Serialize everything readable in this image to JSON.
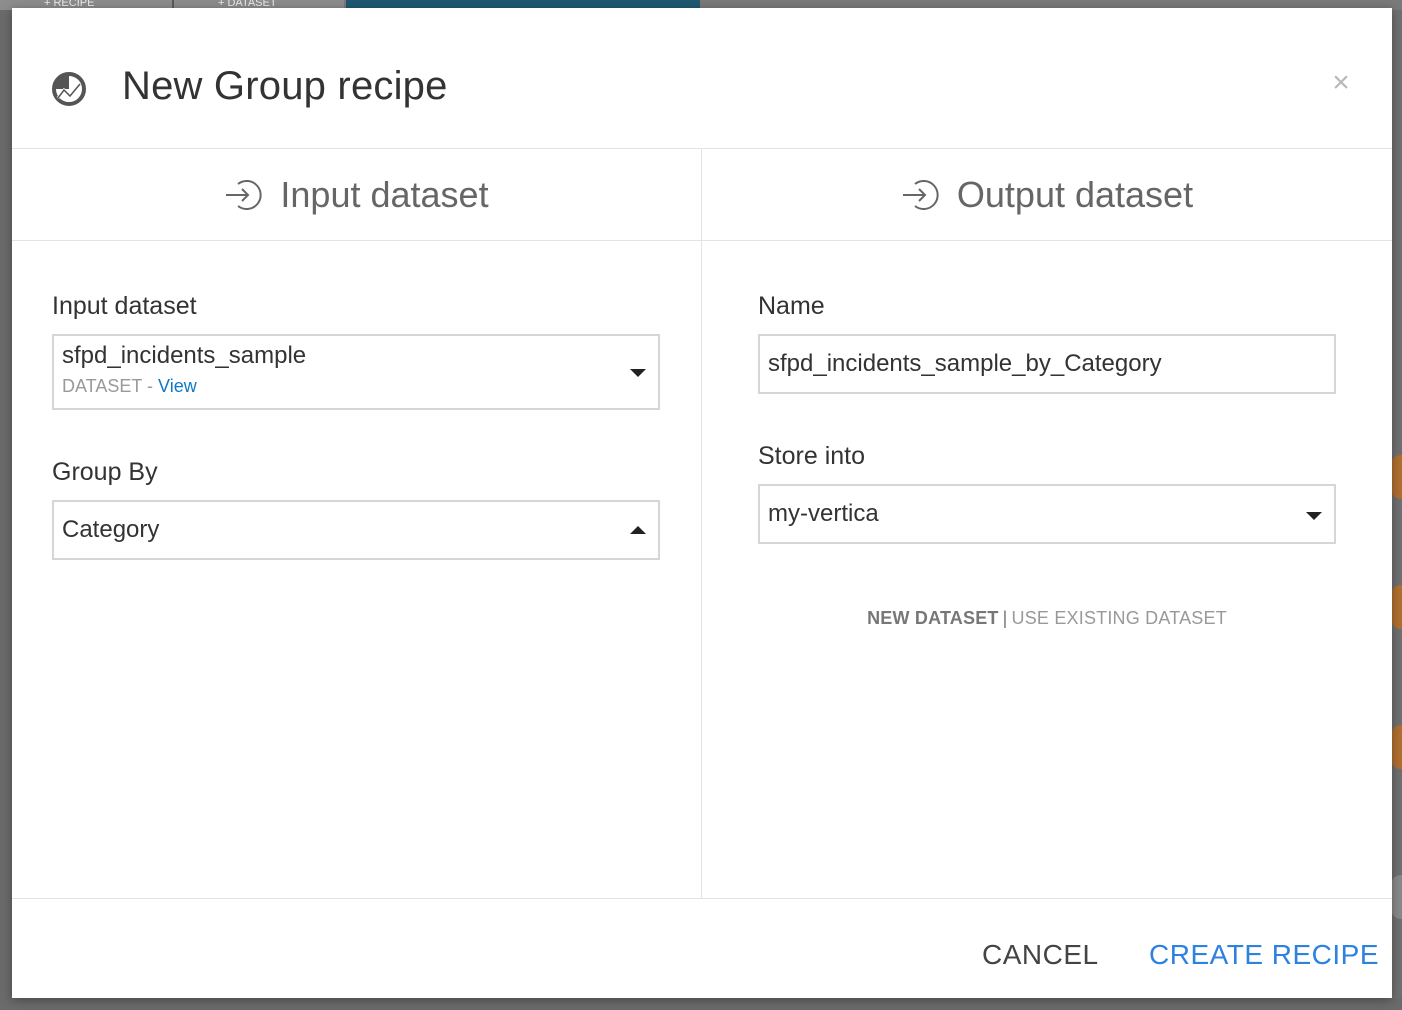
{
  "background": {
    "tabs": [
      "+ RECIPE",
      "+ DATASET"
    ]
  },
  "dialog": {
    "title": "New Group recipe",
    "close_symbol": "×",
    "icon": "recipe-group-icon"
  },
  "input_section": {
    "heading": "Input dataset",
    "icon": "arrow-in-icon",
    "input_dataset": {
      "label": "Input dataset",
      "value": "sfpd_incidents_sample",
      "type_label": "DATASET",
      "separator": " - ",
      "link_label": "View"
    },
    "group_by": {
      "label": "Group By",
      "value": "Category"
    }
  },
  "output_section": {
    "heading": "Output dataset",
    "icon": "arrow-in-icon",
    "name": {
      "label": "Name",
      "value": "sfpd_incidents_sample_by_Category"
    },
    "store_into": {
      "label": "Store into",
      "value": "my-vertica"
    },
    "mode": {
      "new_label": "NEW DATASET",
      "separator": "|",
      "existing_label": "USE EXISTING DATASET"
    }
  },
  "footer": {
    "cancel_label": "CANCEL",
    "create_label": "CREATE RECIPE"
  },
  "colors": {
    "accent": "#2d82e0",
    "link": "#0e7ac7",
    "text": "#333333",
    "muted": "#999999"
  }
}
